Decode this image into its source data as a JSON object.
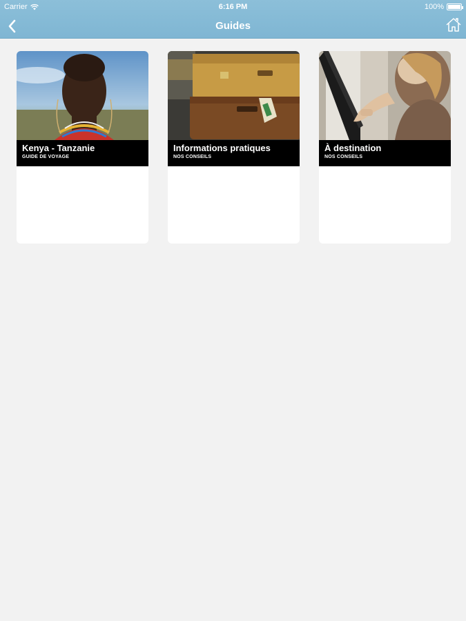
{
  "status_bar": {
    "carrier": "Carrier",
    "time": "6:16 PM",
    "battery": "100%"
  },
  "navbar": {
    "title": "Guides",
    "back_icon": "chevron-left-icon",
    "home_icon": "home-icon"
  },
  "guides": [
    {
      "title": "Kenya - Tanzanie",
      "subtitle": "GUIDE DE VOYAGE"
    },
    {
      "title": "Informations pratiques",
      "subtitle": "NOS CONSEILS"
    },
    {
      "title": "À destination",
      "subtitle": "NOS CONSEILS"
    }
  ]
}
